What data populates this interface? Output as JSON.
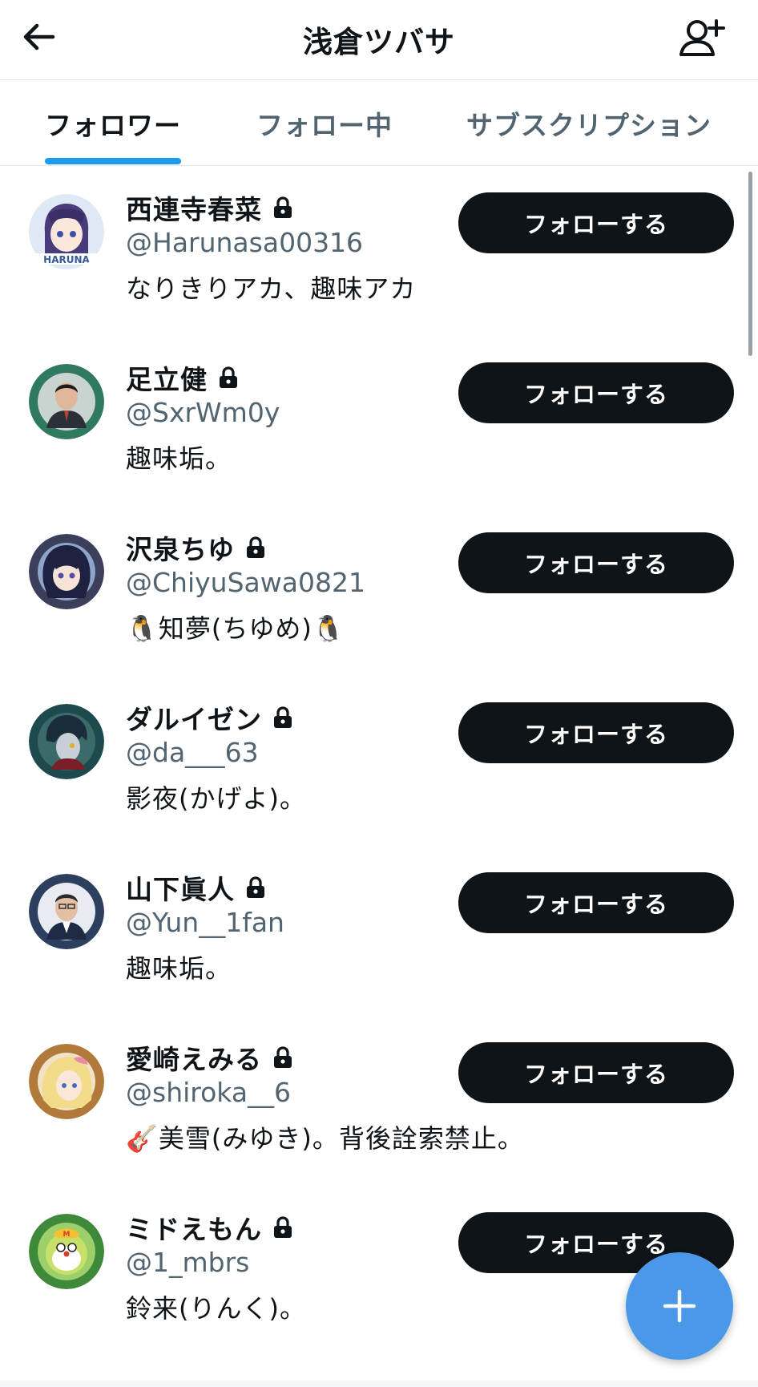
{
  "header": {
    "title": "浅倉ツバサ",
    "back_icon": "arrow-left-icon",
    "add_user_icon": "person-plus-icon"
  },
  "tabs": [
    {
      "label": "フォロワー",
      "active": true
    },
    {
      "label": "フォロー中",
      "active": false
    },
    {
      "label": "サブスクリプション",
      "active": false
    }
  ],
  "colors": {
    "accent": "#1d9bf0",
    "fab": "#4a99e9",
    "button_bg": "#0f1419",
    "secondary_text": "#536471"
  },
  "followers": [
    {
      "name": "西連寺春菜",
      "handle": "@Harunasa00316",
      "bio": "なりきりアカ、趣味アカ",
      "button": "フォローする",
      "locked": true
    },
    {
      "name": "足立健",
      "handle": "@SxrWm0y",
      "bio": "趣味垢。",
      "button": "フォローする",
      "locked": true
    },
    {
      "name": "沢泉ちゆ",
      "handle": "@ChiyuSawa0821",
      "bio": "🐧知夢(ちゆめ)🐧",
      "button": "フォローする",
      "locked": true
    },
    {
      "name": "ダルイゼン",
      "handle": "@da___63",
      "bio": "影夜(かげよ)。",
      "button": "フォローする",
      "locked": true
    },
    {
      "name": "山下眞人",
      "handle": "@Yun__1fan",
      "bio": "趣味垢。",
      "button": "フォローする",
      "locked": true
    },
    {
      "name": "愛崎えみる",
      "handle": "@shiroka__6",
      "bio": "🎸美雪(みゆき)。背後詮索禁止。",
      "button": "フォローする",
      "locked": true
    },
    {
      "name": "ミドえもん",
      "handle": "@1_mbrs",
      "bio": "鈴来(りんく)。",
      "button": "フォローする",
      "locked": true
    }
  ],
  "fab": {
    "icon": "plus-icon"
  }
}
